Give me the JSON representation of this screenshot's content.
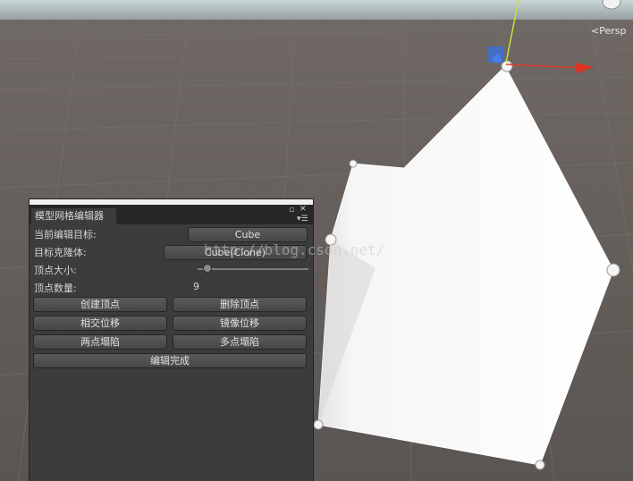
{
  "scene": {
    "view_label": "Persp",
    "view_label_icon": "chevron-left-icon"
  },
  "panel": {
    "tab_title": "模型网格编辑器",
    "rows": {
      "current_target_label": "当前编辑目标:",
      "current_target_value": "Cube",
      "clone_label": "目标克隆体:",
      "clone_value": "Cube(Clone)",
      "vertex_size_label": "顶点大小:",
      "vertex_size_level": 0.05,
      "vertex_count_label": "顶点数量:",
      "vertex_count_value": "9"
    },
    "buttons": {
      "create_vertex": "创建顶点",
      "delete_vertex": "删除顶点",
      "intersect_move": "相交位移",
      "mirror_move": "镜像位移",
      "two_point_collapse": "两点塌陷",
      "multi_point_collapse": "多点塌陷",
      "finish_edit": "编辑完成"
    }
  },
  "watermark": "http://blog.csdn.net/",
  "colors": {
    "panel_bg": "#3c3c3c",
    "scene_bg": "#5f5b58",
    "mesh": "#f2f2f2"
  }
}
